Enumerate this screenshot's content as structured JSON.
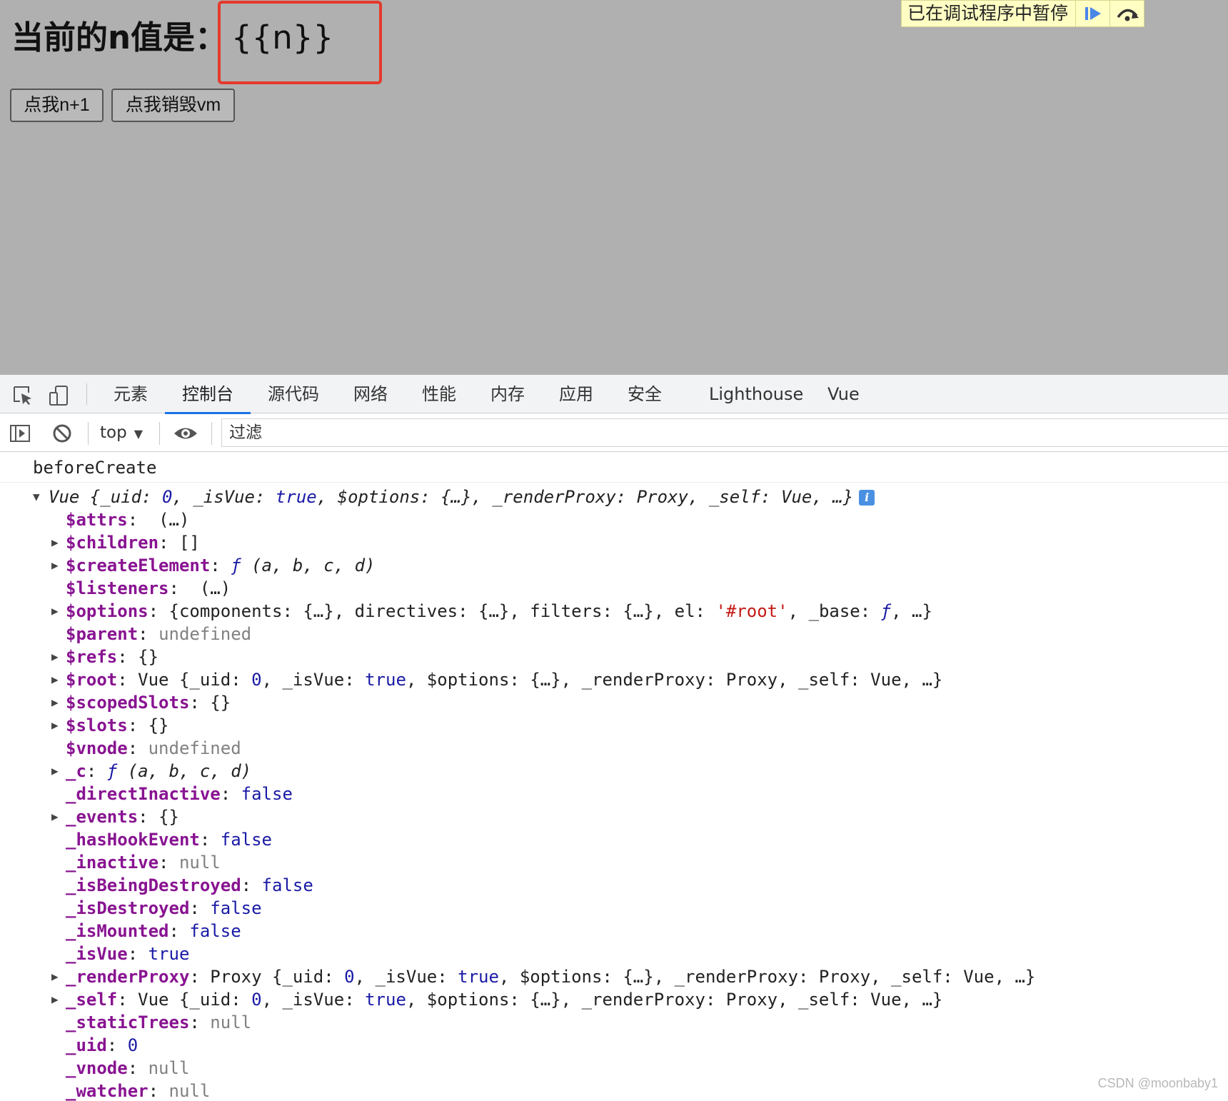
{
  "page": {
    "heading_label": "当前的n值是：",
    "heading_value": "{{n}}",
    "buttons": {
      "increment": "点我n+1",
      "destroy": "点我销毁vm"
    },
    "paused_overlay": {
      "label": "已在调试程序中暂停",
      "resume_icon": "resume-icon",
      "step_over_icon": "step-over-icon"
    }
  },
  "devtools": {
    "tabs": [
      "元素",
      "控制台",
      "源代码",
      "网络",
      "性能",
      "内存",
      "应用",
      "安全",
      "Lighthouse",
      "Vue"
    ],
    "active_tab": "控制台",
    "console_toolbar": {
      "context": "top",
      "filter_placeholder": "过滤"
    }
  },
  "console": {
    "message": "beforeCreate",
    "object_summary": {
      "prefix": "Vue ",
      "open": "{",
      "k_uid": "_uid",
      "v_uid": "0",
      "k_isvue": "_isVue",
      "v_isvue": "true",
      "k_options": "$options",
      "v_options": "{…}",
      "k_renderproxy": "_renderProxy",
      "v_renderproxy": "Proxy",
      "k_self": "_self",
      "v_self": "Vue",
      "tail": "…}"
    },
    "props": {
      "attrs": {
        "key": "$attrs",
        "value": "(…)"
      },
      "children": {
        "key": "$children",
        "value": "[]"
      },
      "createElement": {
        "key": "$createElement",
        "f": "ƒ",
        "args": "(a, b, c, d)"
      },
      "listeners": {
        "key": "$listeners",
        "value": "(…)"
      },
      "options": {
        "key": "$options",
        "open": "{",
        "k1": "components",
        "v1": "{…}",
        "k2": "directives",
        "v2": "{…}",
        "k3": "filters",
        "v3": "{…}",
        "k4": "el",
        "v4": "'#root'",
        "k5": "_base",
        "v5": "ƒ",
        "tail": "…}"
      },
      "parent": {
        "key": "$parent",
        "value": "undefined"
      },
      "refs": {
        "key": "$refs",
        "value": "{}"
      },
      "root": {
        "key": "$root",
        "prefix": "Vue"
      },
      "scopedSlots": {
        "key": "$scopedSlots",
        "value": "{}"
      },
      "slots": {
        "key": "$slots",
        "value": "{}"
      },
      "vnode": {
        "key": "$vnode",
        "value": "undefined"
      },
      "c": {
        "key": "_c",
        "f": "ƒ",
        "args": "(a, b, c, d)"
      },
      "directInactive": {
        "key": "_directInactive",
        "value": "false"
      },
      "events": {
        "key": "_events",
        "value": "{}"
      },
      "hasHookEvent": {
        "key": "_hasHookEvent",
        "value": "false"
      },
      "inactive": {
        "key": "_inactive",
        "value": "null"
      },
      "isBeingDestroyed": {
        "key": "_isBeingDestroyed",
        "value": "false"
      },
      "isDestroyed": {
        "key": "_isDestroyed",
        "value": "false"
      },
      "isMounted": {
        "key": "_isMounted",
        "value": "false"
      },
      "isVue": {
        "key": "_isVue",
        "value": "true"
      },
      "renderProxy": {
        "key": "_renderProxy",
        "prefix": "Proxy"
      },
      "self": {
        "key": "_self",
        "prefix": "Vue"
      },
      "staticTrees": {
        "key": "_staticTrees",
        "value": "null"
      },
      "uid": {
        "key": "_uid",
        "value": "0"
      },
      "vnodeP": {
        "key": "_vnode",
        "value": "null"
      },
      "watcher": {
        "key": "_watcher",
        "value": "null"
      }
    }
  },
  "watermark": "CSDN @moonbaby1",
  "colors": {
    "page_background": "#b0b0b0",
    "highlight_border": "#e5392b",
    "paused_overlay_bg": "#ffffc4",
    "active_tab_indicator": "#1a73e8",
    "property_key": "#881391",
    "keyword": "#1a1aa6",
    "string": "#c41a16",
    "muted": "#808080"
  }
}
